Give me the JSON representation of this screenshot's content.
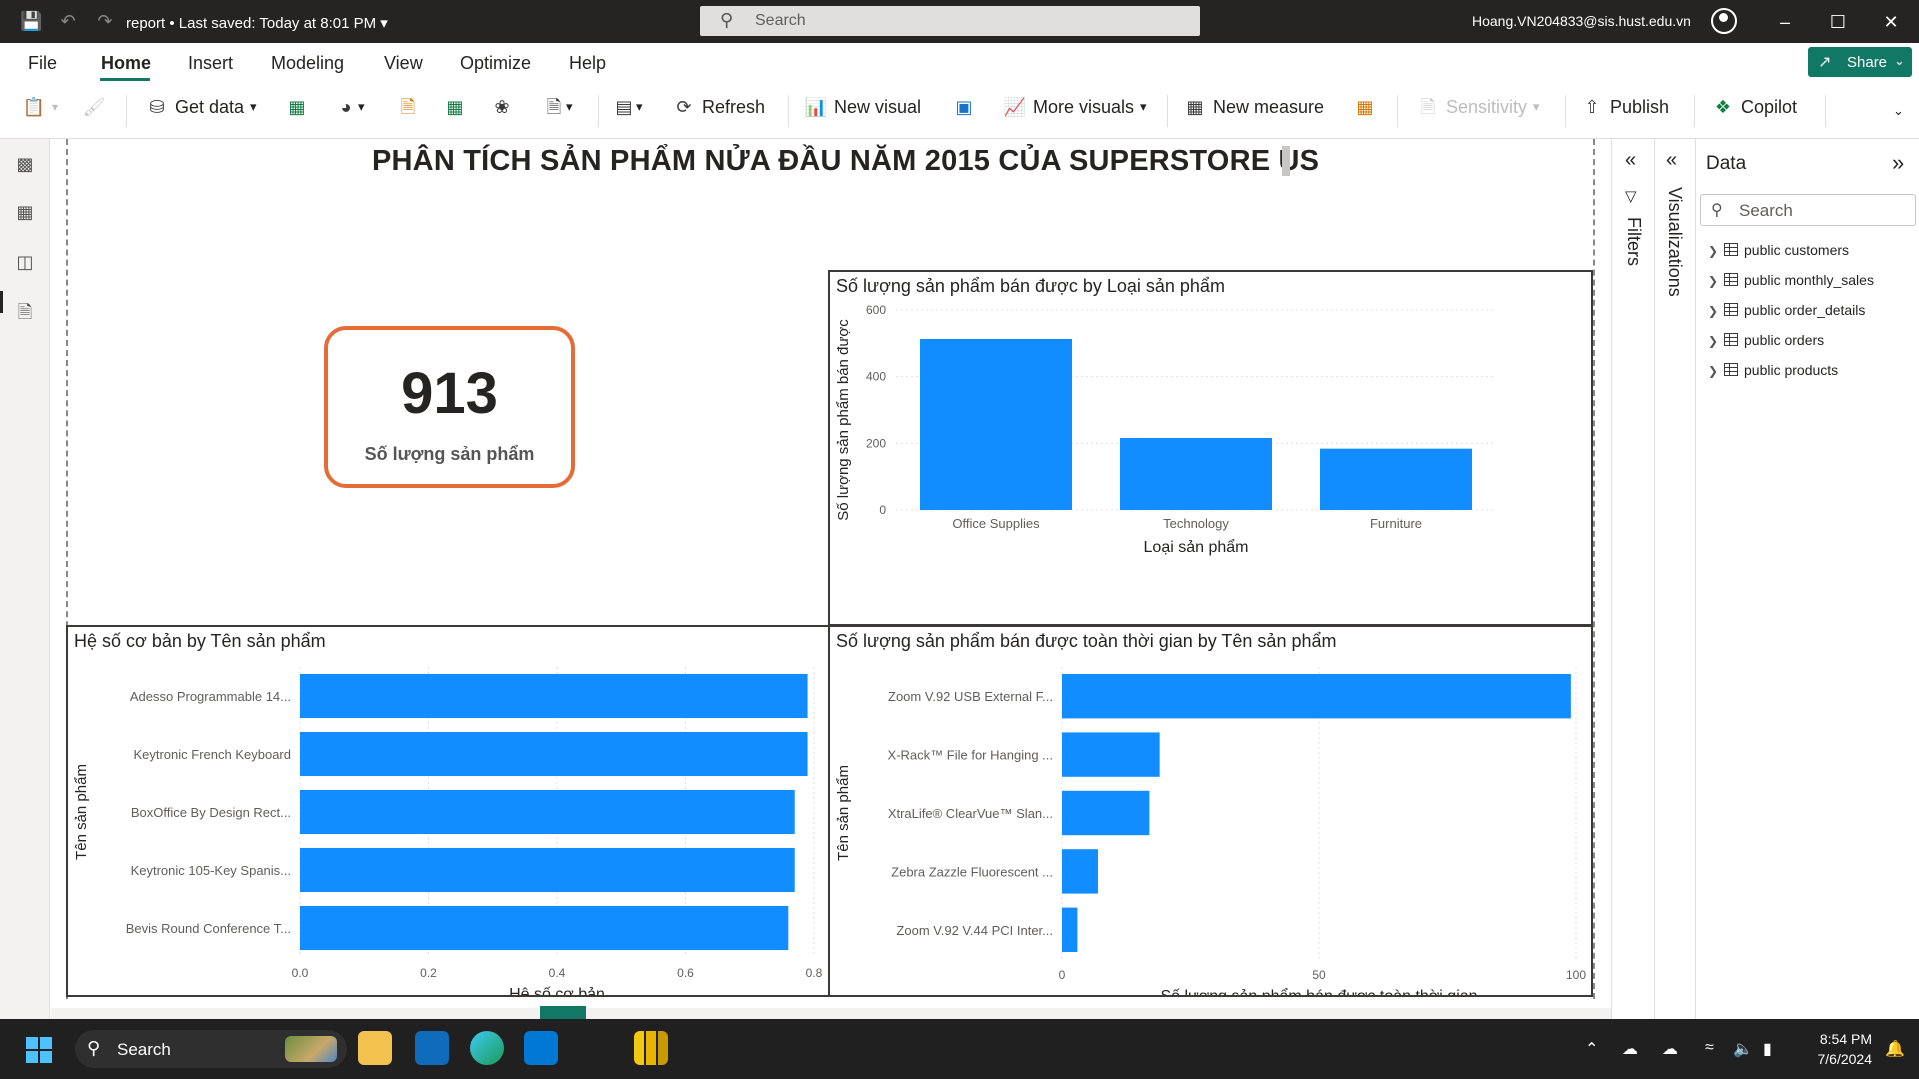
{
  "titlebar": {
    "doc_title": "report • Last saved: Today at 8:01 PM",
    "search_placeholder": "Search",
    "user": "Hoang.VN204833@sis.hust.edu.vn"
  },
  "menu": {
    "items": [
      "File",
      "Home",
      "Insert",
      "Modeling",
      "View",
      "Optimize",
      "Help"
    ],
    "active": "Home",
    "share_label": "Share"
  },
  "ribbon": {
    "get_data": "Get data",
    "refresh": "Refresh",
    "new_visual": "New visual",
    "more_visuals": "More visuals",
    "new_measure": "New measure",
    "sensitivity": "Sensitivity",
    "publish": "Publish",
    "copilot": "Copilot"
  },
  "report": {
    "title": "PHÂN TÍCH SẢN PHẨM NỬA ĐẦU NĂM 2015 CỦA SUPERSTORE US",
    "card_value": "913",
    "card_label": "Số lượng sản phẩm"
  },
  "panes": {
    "filters": "Filters",
    "visualizations": "Visualizations",
    "data_title": "Data",
    "data_search_placeholder": "Search",
    "tables": [
      "public customers",
      "public monthly_sales",
      "public order_details",
      "public orders",
      "public products"
    ]
  },
  "taskbar": {
    "search": "Search",
    "time": "8:54 PM",
    "date": "7/6/2024"
  },
  "colors": {
    "bar": "#118dff",
    "accent": "#117865",
    "card_border": "#e66c37"
  },
  "chart_data": [
    {
      "type": "bar",
      "title": "Số lượng sản phẩm bán được by Loại sản phẩm",
      "categories": [
        "Office Supplies",
        "Technology",
        "Furniture"
      ],
      "values": [
        513,
        216,
        184
      ],
      "xlabel": "Loại sản phẩm",
      "ylabel": "Số lượng sản phẩm bán được",
      "ylim": [
        0,
        600
      ],
      "yticks": [
        "0",
        "200",
        "400",
        "600"
      ],
      "grid": true
    },
    {
      "type": "bar",
      "orientation": "horizontal",
      "title": "Hệ số cơ bản by Tên sản phẩm",
      "categories": [
        "Adesso Programmable 14...",
        "Keytronic French Keyboard",
        "BoxOffice By Design Rect...",
        "Keytronic 105-Key Spanis...",
        "Bevis Round Conference T..."
      ],
      "values": [
        0.79,
        0.79,
        0.77,
        0.77,
        0.76
      ],
      "xlabel": "Hệ số cơ bản",
      "ylabel": "Tên sản phẩm",
      "xlim": [
        0,
        0.8
      ],
      "xticks": [
        "0.0",
        "0.2",
        "0.4",
        "0.6",
        "0.8"
      ],
      "grid": true
    },
    {
      "type": "bar",
      "orientation": "horizontal",
      "title": "Số lượng sản phẩm bán được toàn thời gian by Tên sản phẩm",
      "categories": [
        "Zoom V.92 USB External F...",
        "X-Rack™ File for Hanging ...",
        "XtraLife® ClearVue™ Slan...",
        "Zebra Zazzle Fluorescent ...",
        "Zoom V.92 V.44 PCI Inter..."
      ],
      "values": [
        99,
        19,
        17,
        7,
        3
      ],
      "xlabel": "Số lượng sản phẩm bán được toàn thời gian",
      "ylabel": "Tên sản phẩm",
      "xlim": [
        0,
        100
      ],
      "xticks": [
        "0",
        "50",
        "100"
      ],
      "grid": true
    }
  ]
}
